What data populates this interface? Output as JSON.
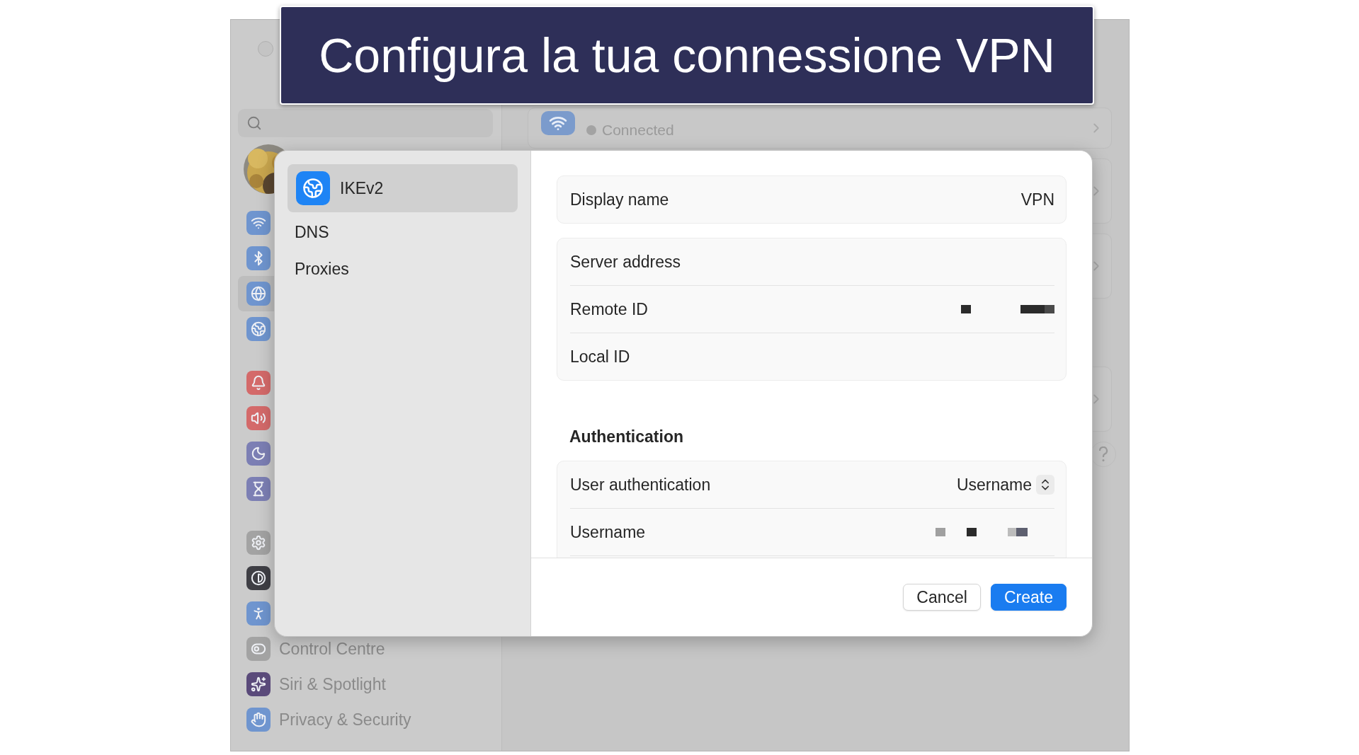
{
  "banner": {
    "title": "Configura la tua connessione VPN"
  },
  "sidebar": {
    "groups": [
      [
        {
          "kind": "wifi",
          "color": "#6f95cf",
          "selected": false
        },
        {
          "kind": "bluetooth",
          "color": "#6f95cf",
          "selected": false
        },
        {
          "kind": "globe",
          "color": "#6f95cf",
          "selected": true
        },
        {
          "kind": "vpn",
          "color": "#6f95cf",
          "selected": false
        }
      ],
      [
        {
          "kind": "bell",
          "color": "#d46a6a",
          "selected": false
        },
        {
          "kind": "sound",
          "color": "#d46a6a",
          "selected": false
        },
        {
          "kind": "moon",
          "color": "#7c7fb4",
          "selected": false
        },
        {
          "kind": "hourglass",
          "color": "#7c7fb4",
          "selected": false
        }
      ],
      [
        {
          "kind": "gear",
          "color": "#a3a3a3",
          "selected": false
        },
        {
          "kind": "appearance",
          "color": "#3f3f45",
          "selected": false
        },
        {
          "kind": "accessibility",
          "color": "#6f95cf",
          "selected": false
        },
        {
          "kind": "toggles",
          "color": "#a3a3a3",
          "label": "Control Centre",
          "selected": false
        },
        {
          "kind": "siri",
          "color": "#5a4a7a",
          "label": "Siri & Spotlight",
          "selected": false
        },
        {
          "kind": "hand",
          "color": "#6f95cf",
          "label": "Privacy & Security",
          "selected": false
        }
      ]
    ]
  },
  "wifi_card": {
    "status": "Connected"
  },
  "dialog": {
    "sections": [
      {
        "label": "IKEv2",
        "kind": "vpn",
        "selected": true
      },
      {
        "label": "DNS",
        "selected": false
      },
      {
        "label": "Proxies",
        "selected": false
      }
    ],
    "general": [
      {
        "label": "Display name",
        "value": "VPN"
      }
    ],
    "connection": [
      {
        "label": "Server address"
      },
      {
        "label": "Remote ID",
        "redacted": true
      },
      {
        "label": "Local ID"
      }
    ],
    "authentication": {
      "heading": "Authentication",
      "rows": [
        {
          "label": "User authentication",
          "kind": "popup",
          "value": "Username"
        },
        {
          "label": "Username",
          "kind": "text",
          "redacted": true
        }
      ]
    },
    "buttons": [
      {
        "label": "Cancel",
        "primary": false
      },
      {
        "label": "Create",
        "primary": true
      }
    ]
  }
}
